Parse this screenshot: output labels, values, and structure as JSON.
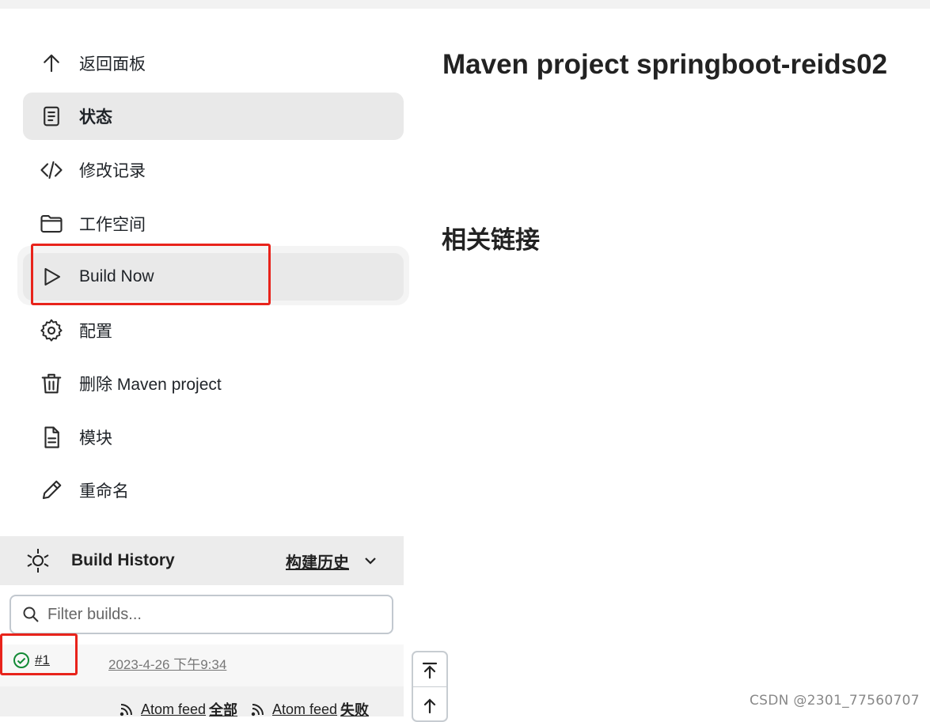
{
  "sidebar": {
    "items": [
      {
        "label": "返回面板",
        "icon": "arrow-up-icon"
      },
      {
        "label": "状态",
        "icon": "document-icon"
      },
      {
        "label": "修改记录",
        "icon": "code-icon"
      },
      {
        "label": "工作空间",
        "icon": "folder-icon"
      },
      {
        "label": "Build Now",
        "icon": "play-icon"
      },
      {
        "label": "配置",
        "icon": "gear-icon"
      },
      {
        "label": "删除 Maven project",
        "icon": "trash-icon"
      },
      {
        "label": "模块",
        "icon": "file-icon"
      },
      {
        "label": "重命名",
        "icon": "pencil-icon"
      }
    ]
  },
  "main": {
    "title": "Maven project springboot-reids02",
    "related_links_heading": "相关链接"
  },
  "build_history": {
    "title": "Build History",
    "trend_label": "构建历史",
    "filter_placeholder": "Filter builds...",
    "builds": [
      {
        "number": "#1",
        "time": "2023-4-26 下午9:34",
        "status": "success"
      }
    ],
    "feeds": [
      {
        "prefix": "Atom feed",
        "label": "全部"
      },
      {
        "prefix": "Atom feed",
        "label": "失败"
      }
    ]
  },
  "watermark": "CSDN @2301_77560707",
  "colors": {
    "highlight_box": "#e8231b",
    "success": "#138a36",
    "active_bg": "#e9e9e9"
  }
}
